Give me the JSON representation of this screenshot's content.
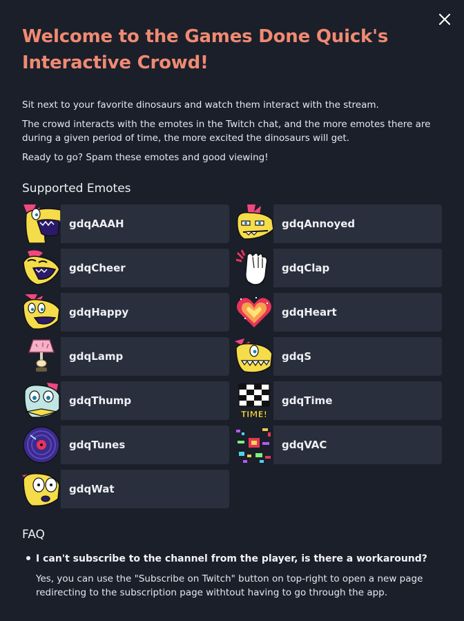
{
  "modal": {
    "title": "Welcome to the Games Done Quick's Interactive Crowd!",
    "close_icon": "close-icon",
    "intro": [
      "Sit next to your favorite dinosaurs and watch them interact with the stream.",
      "The crowd interacts with the emotes in the Twitch chat, and the more emotes there are during a given period of time, the more excited the dinosaurs will get.",
      "Ready to go? Spam these emotes and good viewing!"
    ]
  },
  "emotes_section": {
    "heading": "Supported Emotes",
    "emotes": [
      {
        "name": "gdqAAAH",
        "icon": "dino-scream-icon"
      },
      {
        "name": "gdqAnnoyed",
        "icon": "dino-annoyed-icon"
      },
      {
        "name": "gdqCheer",
        "icon": "dino-cheer-icon"
      },
      {
        "name": "gdqClap",
        "icon": "clapping-hand-icon"
      },
      {
        "name": "gdqHappy",
        "icon": "dino-happy-icon"
      },
      {
        "name": "gdqHeart",
        "icon": "pixel-heart-icon"
      },
      {
        "name": "gdqLamp",
        "icon": "lamp-icon"
      },
      {
        "name": "gdqS",
        "icon": "dino-grin-icon"
      },
      {
        "name": "gdqThump",
        "icon": "dino-thump-icon"
      },
      {
        "name": "gdqTime",
        "icon": "checkered-flag-icon"
      },
      {
        "name": "gdqTunes",
        "icon": "vinyl-disc-icon"
      },
      {
        "name": "gdqVAC",
        "icon": "vac-glitch-icon"
      },
      {
        "name": "gdqWat",
        "icon": "dino-wat-icon"
      }
    ],
    "time_badge": "TIME!"
  },
  "faq": {
    "heading": "FAQ",
    "items": [
      {
        "question": "I can't subscribe to the channel from the player, is there a workaround?",
        "answer": "Yes, you can use the \"Subscribe on Twitch\" button on top-right to open a new page redirecting to the subscription page withtout having to go through the app."
      }
    ]
  },
  "colors": {
    "background": "#1b1f2a",
    "card": "#2a2f3d",
    "title_accent": "#f08a72",
    "text": "#e6e8ee"
  }
}
